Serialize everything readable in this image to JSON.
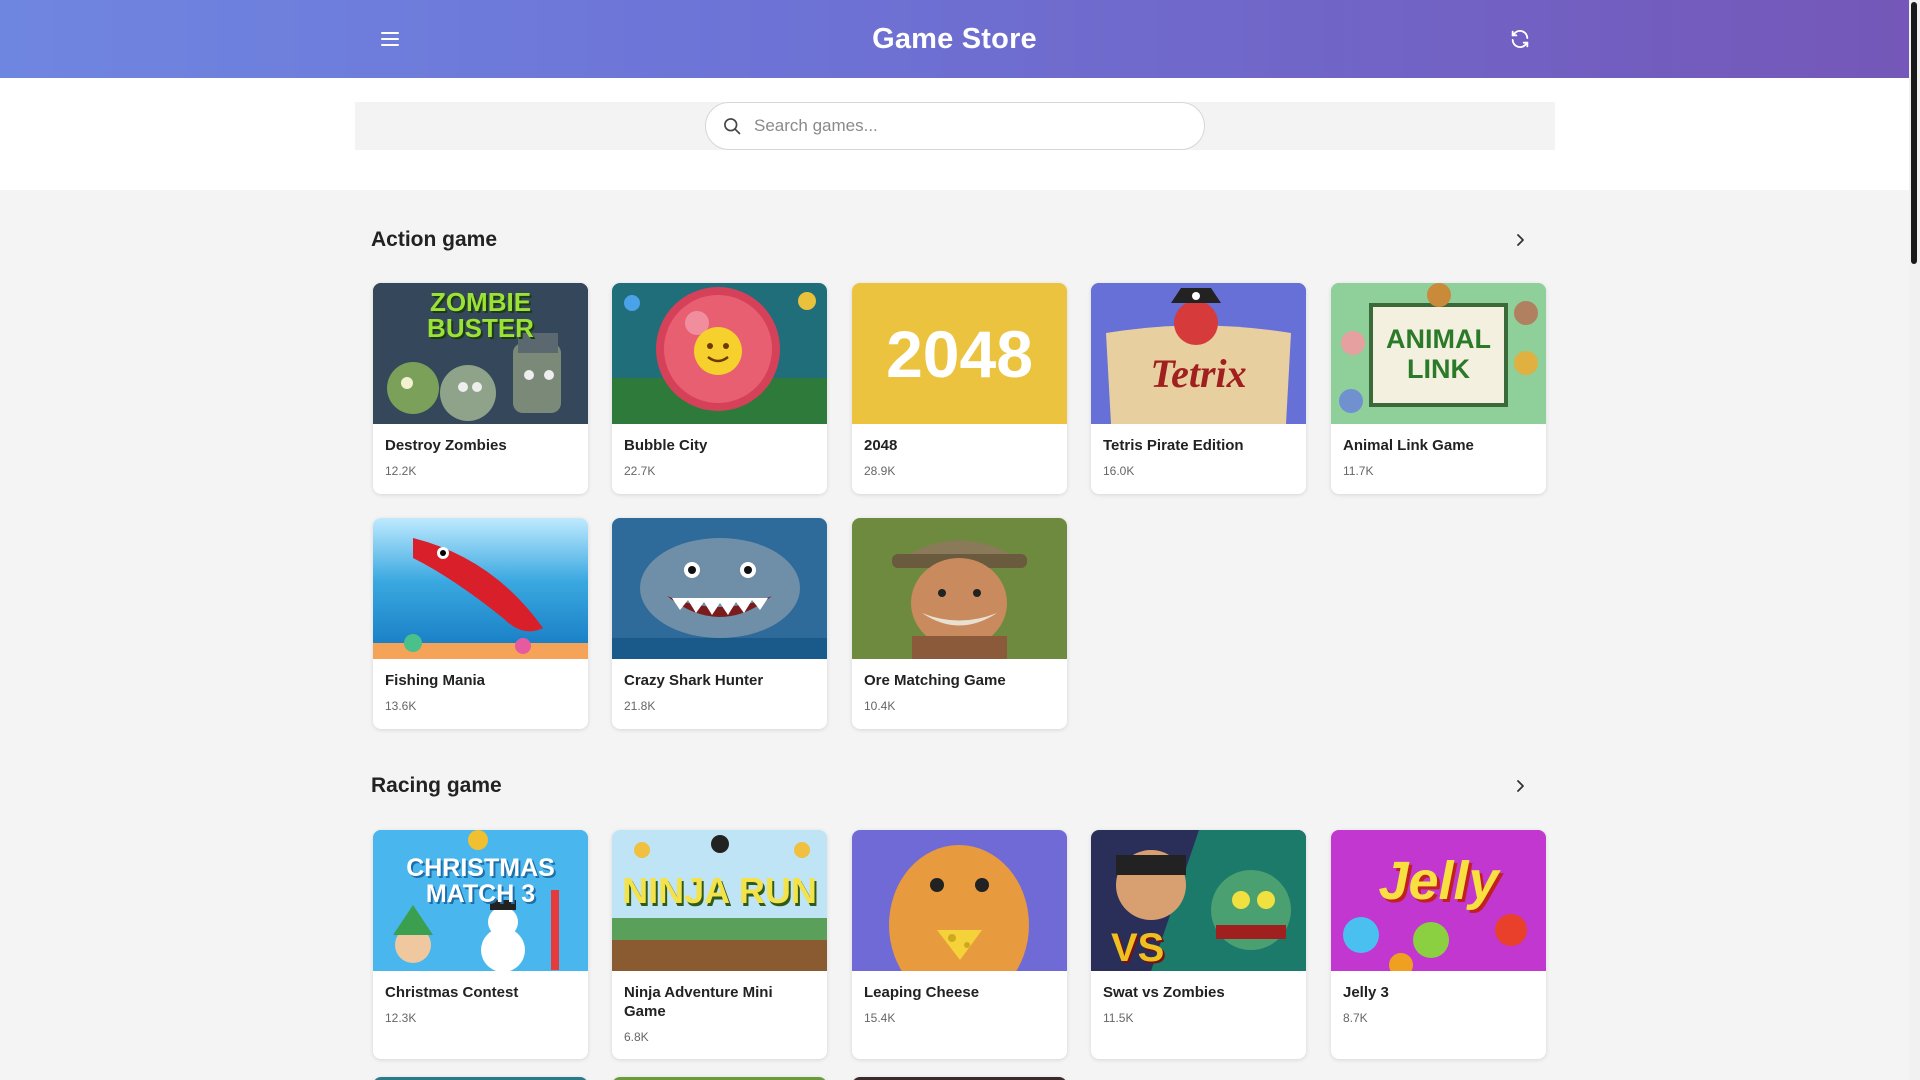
{
  "header": {
    "title": "Game Store"
  },
  "search": {
    "placeholder": "Search games..."
  },
  "sections": [
    {
      "title": "Action game",
      "games": [
        {
          "name": "Destroy Zombies",
          "plays": "12.2K",
          "art_text": "ZOMBIE BUSTER"
        },
        {
          "name": "Bubble City",
          "plays": "22.7K"
        },
        {
          "name": "2048",
          "plays": "28.9K",
          "art_text": "2048"
        },
        {
          "name": "Tetris Pirate Edition",
          "plays": "16.0K",
          "art_text": "Tetrix"
        },
        {
          "name": "Animal Link Game",
          "plays": "11.7K",
          "art_text": "ANIMAL LINK"
        },
        {
          "name": "Fishing Mania",
          "plays": "13.6K"
        },
        {
          "name": "Crazy Shark Hunter",
          "plays": "21.8K"
        },
        {
          "name": "Ore Matching Game",
          "plays": "10.4K"
        }
      ]
    },
    {
      "title": "Racing game",
      "games": [
        {
          "name": "Christmas Contest",
          "plays": "12.3K",
          "art_text": "CHRISTMAS MATCH 3"
        },
        {
          "name": "Ninja Adventure Mini Game",
          "plays": "6.8K",
          "art_text": "NINJA RUN"
        },
        {
          "name": "Leaping Cheese",
          "plays": "15.4K"
        },
        {
          "name": "Swat vs Zombies",
          "plays": "11.5K",
          "art_text": "VS"
        },
        {
          "name": "Jelly 3",
          "plays": "8.7K",
          "art_text": "Jelly"
        }
      ]
    }
  ],
  "colors": {
    "header_start": "#6f86e0",
    "header_end": "#7457b8",
    "page_bg": "#f4f4f4",
    "card_bg": "#ffffff"
  },
  "icons": {
    "menu": "hamburger-icon",
    "refresh": "refresh-icon",
    "search": "search-icon",
    "more": "chevron-right-icon"
  }
}
